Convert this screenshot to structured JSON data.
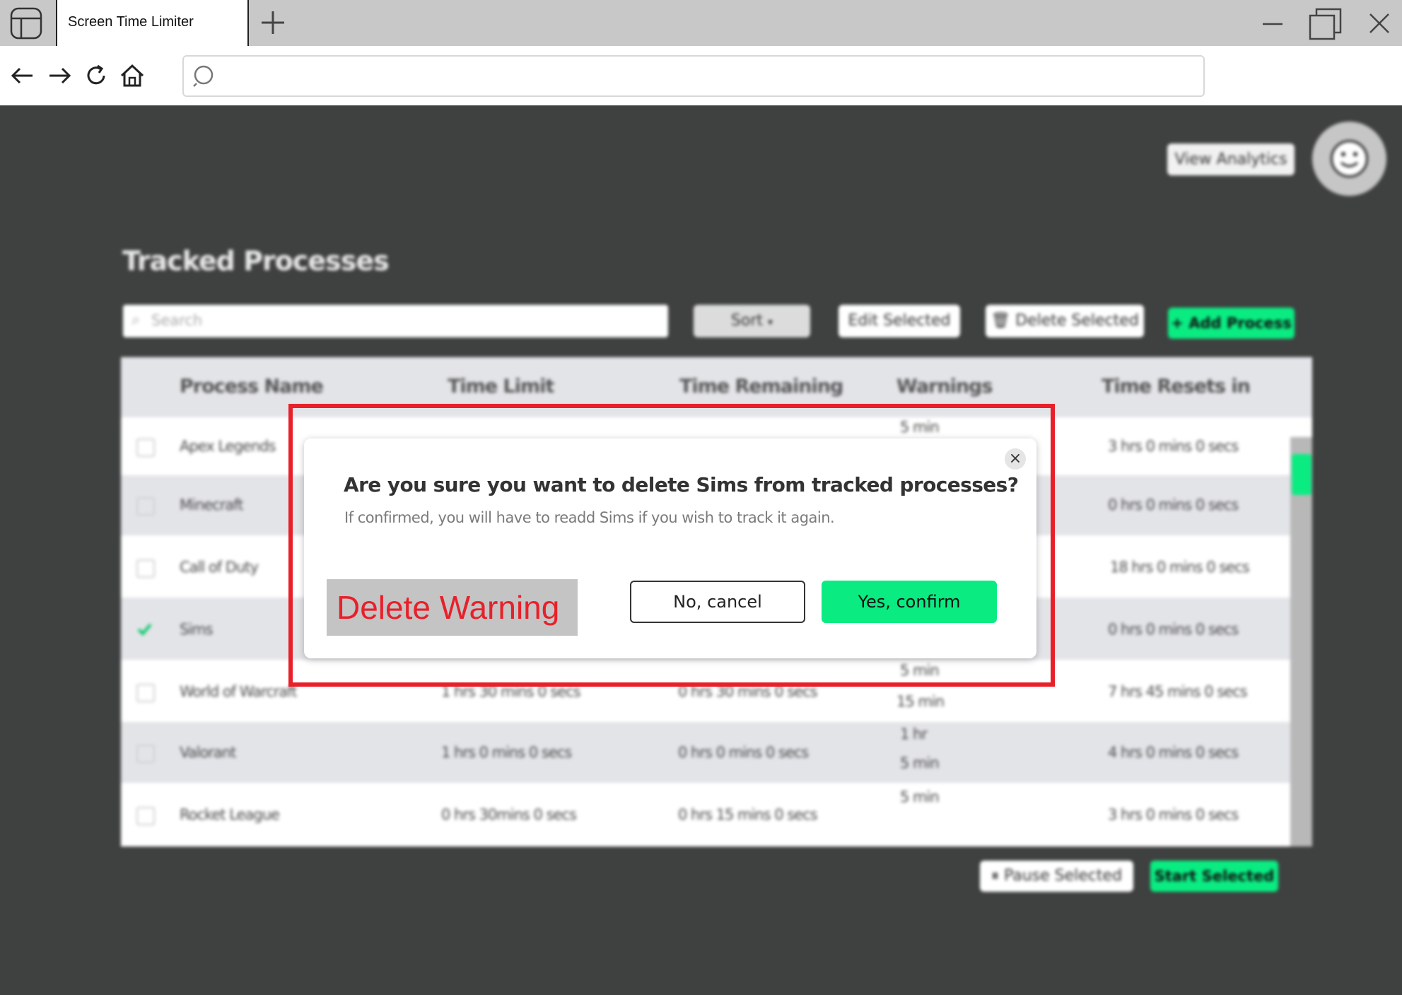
{
  "browser": {
    "tab_title": "Screen Time Limiter",
    "address_value": ""
  },
  "header": {
    "analytics_label": "View Analytics"
  },
  "page": {
    "title": "Tracked Processes"
  },
  "toolbar": {
    "search_placeholder": "Search",
    "sort_label": "Sort",
    "edit_label": "Edit Selected",
    "delete_label": "Delete Selected",
    "add_label": "Add Process"
  },
  "table": {
    "columns": [
      "Process Name",
      "Time Limit",
      "Time Remaining",
      "Warnings",
      "Time Resets in"
    ],
    "rows": [
      {
        "name": "Apex Legends",
        "limit": "",
        "remaining": "",
        "warnings": [
          "5 min"
        ],
        "resets": "3 hrs 0 mins 0 secs",
        "checked": false
      },
      {
        "name": "Minecraft",
        "limit": "",
        "remaining": "",
        "warnings": [],
        "resets": "0 hrs 0 mins 0 secs",
        "checked": false
      },
      {
        "name": "Call of Duty",
        "limit": "",
        "remaining": "",
        "warnings": [],
        "resets": "18 hrs 0 mins 0 secs",
        "checked": false
      },
      {
        "name": "Sims",
        "limit": "",
        "remaining": "",
        "warnings": [],
        "resets": "0 hrs 0 mins 0 secs",
        "checked": true
      },
      {
        "name": "World of Warcraft",
        "limit": "1 hrs 30 mins 0 secs",
        "remaining": "0 hrs 30 mins 0 secs",
        "warnings": [
          "5 min",
          "15 min"
        ],
        "resets": "7 hrs 45 mins 0 secs",
        "checked": false
      },
      {
        "name": "Valorant",
        "limit": "1 hrs 0 mins 0 secs",
        "remaining": "0 hrs 0 mins 0 secs",
        "warnings": [
          "1 hr",
          "5 min"
        ],
        "resets": "4 hrs 0 mins 0 secs",
        "checked": false
      },
      {
        "name": "Rocket League",
        "limit": "0 hrs 30mins 0 secs",
        "remaining": "0 hrs 15 mins 0 secs",
        "warnings": [
          "5 min"
        ],
        "resets": "3 hrs 0 mins 0 secs",
        "checked": false
      }
    ]
  },
  "footer": {
    "pause_label": "Pause Selected",
    "start_label": "Start Selected"
  },
  "dialog": {
    "title": "Are you sure you want to delete Sims from tracked processes?",
    "message": "If confirmed, you will have to readd Sims if you wish to track it again.",
    "close_symbol": "×",
    "cancel_label": "No, cancel",
    "confirm_label": "Yes, confirm"
  },
  "annotation": {
    "label": "Delete Warning",
    "color": "#e8202a"
  },
  "colors": {
    "accent_green": "#0aec82",
    "background": "#3f4140"
  }
}
